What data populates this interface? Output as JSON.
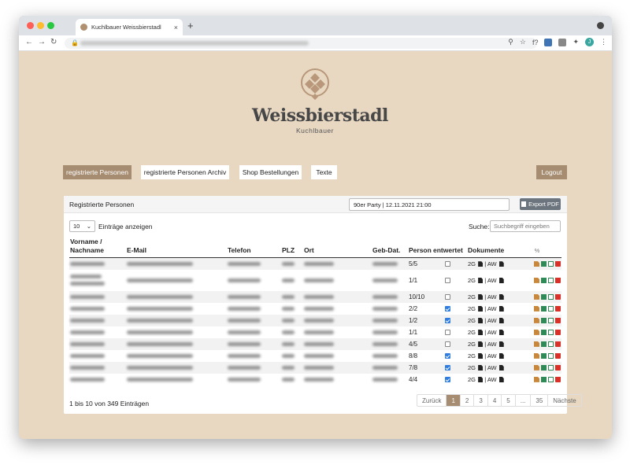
{
  "browser": {
    "tab_title": "Kuchlbauer Weissbierstadl",
    "new_tab": "+",
    "tab_close": "×",
    "back": "←",
    "forward": "→",
    "reload": "↻",
    "lock": "🔒",
    "zoom": "⚲",
    "star": "☆",
    "ext_f": "f?",
    "puzzle": "✦",
    "avatar": "J",
    "menu": "⋮"
  },
  "logo": {
    "title": "Weissbierstadl",
    "subtitle": "Kuchlbauer"
  },
  "nav": {
    "registered": "registrierte Personen",
    "archive": "registrierte Personen Archiv",
    "shop": "Shop Bestellungen",
    "texts": "Texte",
    "logout": "Logout"
  },
  "card": {
    "title": "Registrierte Personen",
    "event": "90er Party | 12.11.2021 21:00",
    "export": "Export PDF",
    "length_value": "10",
    "length_label": "Einträge anzeigen",
    "search_label": "Suche:",
    "search_placeholder": "Suchbegriff eingeben",
    "info": "1 bis 10 von 349 Einträgen"
  },
  "table": {
    "headers": {
      "name": "Vorname / Nachname",
      "email": "E-Mail",
      "phone": "Telefon",
      "zip": "PLZ",
      "city": "Ort",
      "dob": "Geb-Dat.",
      "person": "Person",
      "devalued": "entwertet",
      "docs": "Dokumente",
      "percent": "%"
    },
    "doc_labels": {
      "g2": "2G",
      "sep": "|",
      "aw": "AW"
    },
    "rows": [
      {
        "email": "dreselthomas@gmx.de",
        "person": "5/5",
        "checked": false
      },
      {
        "email": "Kochszy-ver@web.de",
        "person": "1/1",
        "checked": false
      },
      {
        "email": "mgruber80@gmail",
        "person": "10/10",
        "checked": false
      },
      {
        "email": "beth.selina2003@gmail.com",
        "person": "2/2",
        "checked": true
      },
      {
        "email": "Julia.widmann2@gmail.com",
        "person": "1/2",
        "checked": true
      },
      {
        "email": "silvia18huber93@yahoo.de",
        "person": "1/1",
        "checked": false
      },
      {
        "email": "margarete_dressel@web.de",
        "person": "4/5",
        "checked": false
      },
      {
        "email": "lenakoenig1993@gmail.com",
        "person": "8/8",
        "checked": true
      },
      {
        "email": "oliver-barth1990@web.de",
        "person": "7/8",
        "checked": true
      },
      {
        "email": "andi.kellerer@gmail.com",
        "person": "4/4",
        "checked": true
      }
    ]
  },
  "pagination": {
    "prev": "Zurück",
    "pages": [
      "1",
      "2",
      "3",
      "4",
      "5",
      "...",
      "35"
    ],
    "next": "Nächste"
  }
}
